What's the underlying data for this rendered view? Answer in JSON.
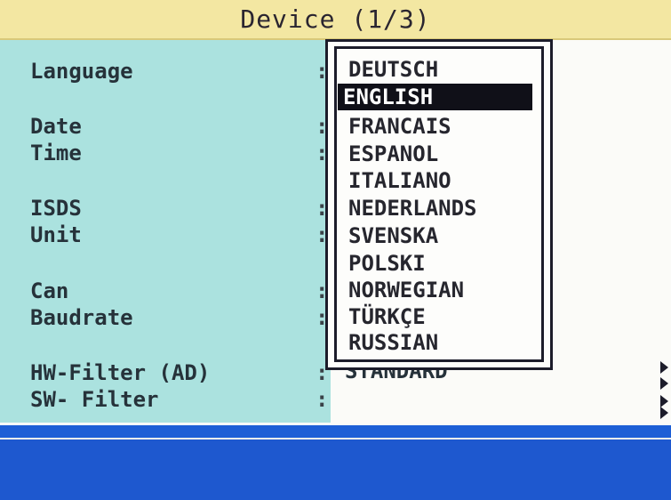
{
  "window": {
    "title": "Device (1/3)"
  },
  "settings": {
    "language": "Language",
    "date": "Date",
    "time": "Time",
    "isds": "ISDS",
    "unit": "Unit",
    "can": "Can",
    "baudrate": "Baudrate",
    "hw_filter": "HW-Filter (AD)",
    "sw_filter": "SW- Filter",
    "colon": ":",
    "hw_filter_value": "STANDARD"
  },
  "language_dropdown": {
    "options": [
      "DEUTSCH",
      "ENGLISH",
      "FRANCAIS",
      "ESPANOL",
      "ITALIANO",
      "NEDERLANDS",
      "SVENSKA",
      "POLSKI",
      "NORWEGIAN",
      "TÜRKÇE",
      "RUSSIAN"
    ],
    "selected": "ENGLISH"
  },
  "icons": {
    "row_arrow": "triangle-right-icon"
  },
  "colors": {
    "title_bg": "#f3e7a2",
    "label_panel_bg": "#abe2df",
    "selection_bg": "#101018",
    "status_bar": "#1e58cf"
  }
}
